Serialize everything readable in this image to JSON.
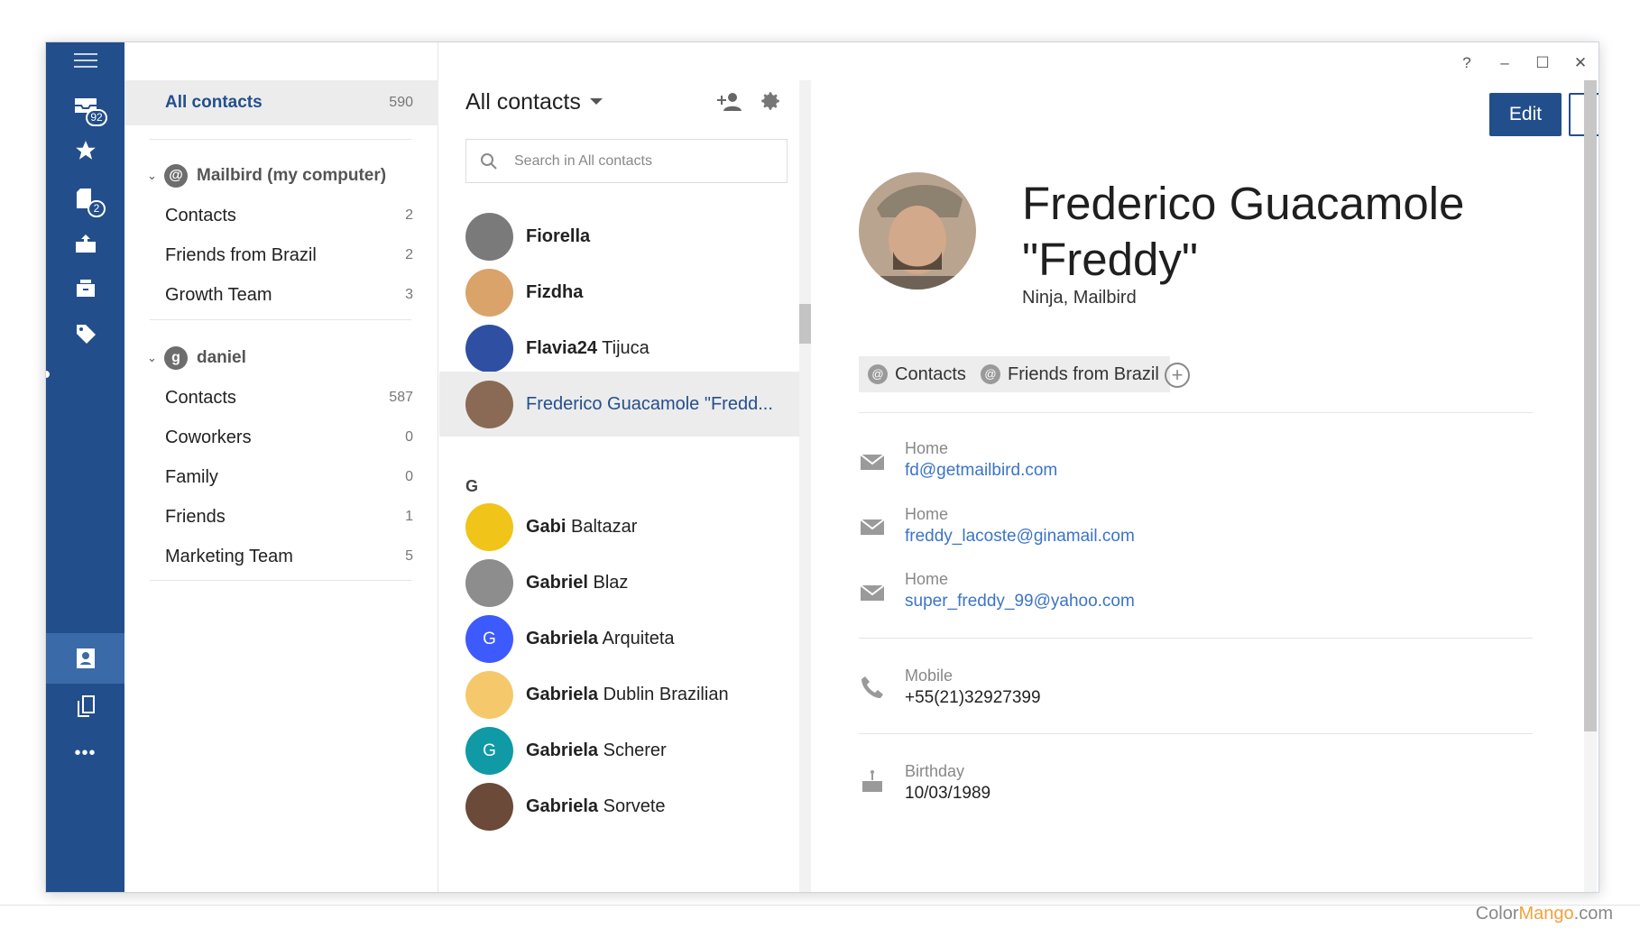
{
  "window": {
    "help": "?",
    "minimize": "–",
    "maximize": "☐",
    "close": "✕"
  },
  "rail": {
    "inbox_badge": "92",
    "drafts_badge": "2",
    "more": "•••"
  },
  "folders": {
    "all_contacts": {
      "label": "All contacts",
      "count": "590"
    },
    "accounts": [
      {
        "label": "Mailbird (my computer)",
        "icon": "at-icon",
        "items": [
          {
            "label": "Contacts",
            "count": "2"
          },
          {
            "label": "Friends from Brazil",
            "count": "2"
          },
          {
            "label": "Growth Team",
            "count": "3"
          }
        ]
      },
      {
        "label": "daniel",
        "icon": "google-icon",
        "items": [
          {
            "label": "Contacts",
            "count": "587"
          },
          {
            "label": "Coworkers",
            "count": "0"
          },
          {
            "label": "Family",
            "count": "0"
          },
          {
            "label": "Friends",
            "count": "1"
          },
          {
            "label": "Marketing Team",
            "count": "5"
          }
        ]
      }
    ]
  },
  "list": {
    "title": "All contacts",
    "search_placeholder": "Search in All contacts",
    "group_letter": "G",
    "contacts": [
      {
        "first": "Fiorella",
        "last": "",
        "avatar": "photo",
        "color": "#7a7a7a"
      },
      {
        "first": "Fizdha",
        "last": "",
        "avatar": "photo",
        "color": "#d9a36a"
      },
      {
        "first": "Flavia24",
        "last": "Tijuca",
        "avatar": "photo",
        "color": "#2f4fa3"
      },
      {
        "first": "Frederico Guacamole \"Fredd...",
        "last": "",
        "avatar": "photo",
        "color": "#8a6a55",
        "selected": true
      },
      {
        "first": "Gabi",
        "last": "Baltazar",
        "avatar": "photo",
        "color": "#f0c419"
      },
      {
        "first": "Gabriel",
        "last": "Blaz",
        "avatar": "photo",
        "color": "#8d8d8d"
      },
      {
        "first": "Gabriela",
        "last": "Arquiteta",
        "avatar": "G",
        "color": "#3d5afe"
      },
      {
        "first": "Gabriela",
        "last": "Dublin Brazilian",
        "avatar": "photo",
        "color": "#f5c86b"
      },
      {
        "first": "Gabriela",
        "last": "Scherer",
        "avatar": "G",
        "color": "#0f9aa6"
      },
      {
        "first": "Gabriela",
        "last": "Sorvete",
        "avatar": "photo",
        "color": "#6b4a3a"
      }
    ]
  },
  "detail": {
    "edit_label": "Edit",
    "name_line1": "Frederico Guacamole",
    "name_line2": "\"Freddy\"",
    "job": "Ninja, Mailbird",
    "tags": [
      "Contacts",
      "Friends from Brazil"
    ],
    "emails": [
      {
        "type": "Home",
        "value": "fd@getmailbird.com"
      },
      {
        "type": "Home",
        "value": "freddy_lacoste@ginamail.com"
      },
      {
        "type": "Home",
        "value": "super_freddy_99@yahoo.com"
      }
    ],
    "phone": {
      "type": "Mobile",
      "value": "+55(21)32927399"
    },
    "birthday": {
      "type": "Birthday",
      "value": "10/03/1989"
    }
  },
  "watermark": {
    "part1": "Color",
    "part2": "Mango",
    "part3": ".com"
  }
}
